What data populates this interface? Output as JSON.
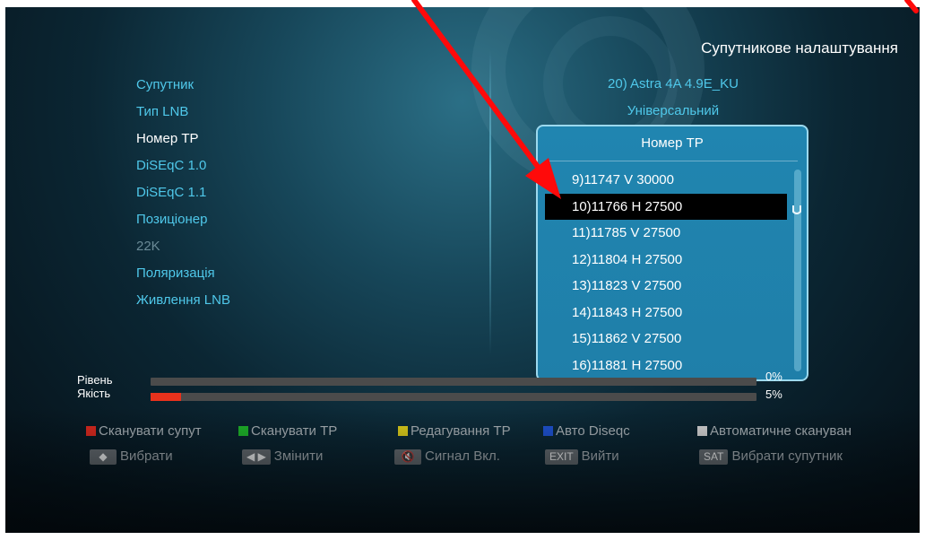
{
  "header": {
    "title": "Супутникове налаштування"
  },
  "menu": {
    "items": [
      {
        "label": "Супутник",
        "state": "normal"
      },
      {
        "label": "Тип LNB",
        "state": "normal"
      },
      {
        "label": "Номер TP",
        "state": "active"
      },
      {
        "label": "DiSEqC 1.0",
        "state": "normal"
      },
      {
        "label": "DiSEqC 1.1",
        "state": "normal"
      },
      {
        "label": "Позиціонер",
        "state": "normal"
      },
      {
        "label": "22K",
        "state": "disabled"
      },
      {
        "label": "Поляризація",
        "state": "normal"
      },
      {
        "label": "Живлення LNB",
        "state": "normal"
      }
    ]
  },
  "values": {
    "satellite": "20) Astra 4A 4.9E_KU",
    "lnb_type": "Універсальний"
  },
  "popup": {
    "title": "Номер TP",
    "items": [
      "9)11747 V 30000",
      "10)11766 H 27500",
      "11)11785 V 27500",
      "12)11804 H 27500",
      "13)11823 V 27500",
      "14)11843 H 27500",
      "15)11862 V 27500",
      "16)11881 H 27500"
    ],
    "selected_index": 1
  },
  "meters": {
    "level": {
      "label": "Рівень",
      "percent_text": "0%",
      "value": 0
    },
    "quality": {
      "label": "Якість",
      "percent_text": "5%",
      "value": 5
    }
  },
  "legend": {
    "row1": [
      {
        "color": "#e02a1f",
        "label": "Сканувати супут"
      },
      {
        "color": "#1fb82a",
        "label": "Сканувати TP"
      },
      {
        "color": "#e3d21b",
        "label": "Редагування TP"
      },
      {
        "color": "#1f54d6",
        "label": "Авто Diseqc"
      },
      {
        "color": "#d8d8d8",
        "label": "Автоматичне сканувaн"
      }
    ],
    "row2": [
      {
        "key": "◆",
        "key_icon": "up-down-arrows-icon",
        "label": "Вибрати"
      },
      {
        "key": "◀ ▶",
        "key_icon": "left-right-arrows-icon",
        "label": "Змінити"
      },
      {
        "key": "🔇",
        "key_icon": "mute-icon",
        "label": "Сигнал Вкл."
      },
      {
        "key": "EXIT",
        "key_icon": "exit-key-icon",
        "label": "Вийти"
      },
      {
        "key": "SAT",
        "key_icon": "sat-key-icon",
        "label": "Вибрати супутник"
      }
    ]
  },
  "colors": {
    "accent_cyan": "#4fc8ea",
    "popup_bg": "#2085b0",
    "annotation_arrow": "#ff0a0a"
  }
}
